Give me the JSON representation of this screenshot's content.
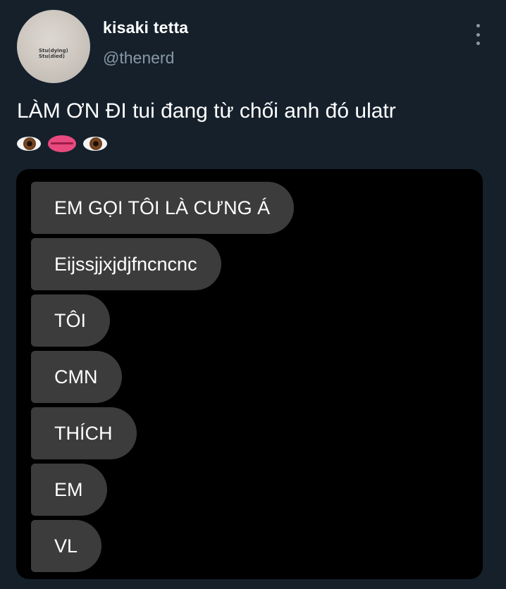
{
  "tweet": {
    "display_name": "kisaki tetta",
    "handle": "@thenerd",
    "avatar_text": [
      "Stu(dying)",
      "Stu(died)"
    ],
    "text": "LÀM ƠN ĐI tui đang từ chối anh đó ulatr",
    "emojis": [
      "eye-emoji",
      "lips-emoji",
      "eye-emoji"
    ]
  },
  "chat": {
    "messages": [
      "EM GỌI TÔI LÀ CƯNG Á",
      "Eijssjjxjdjfncncnc",
      "TÔI",
      "CMN",
      "THÍCH",
      "EM",
      "VL"
    ]
  },
  "colors": {
    "background": "#15202b",
    "secondary_text": "#8899a6",
    "media_background": "#000000",
    "bubble": "#3c3c3c"
  }
}
